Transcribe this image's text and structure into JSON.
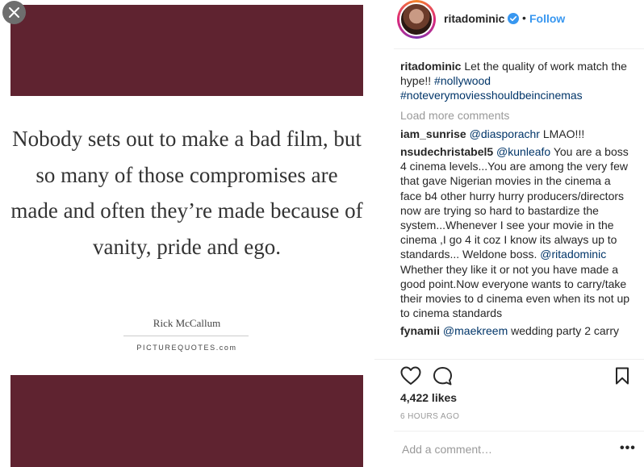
{
  "quote": {
    "text": "Nobody sets out to make a bad film, but so many of those compromises are made and often they’re made because of vanity, pride and ego.",
    "author": "Rick McCallum",
    "site": "PICTUREQUOTES.com"
  },
  "post": {
    "username": "ritadominic",
    "follow_label": "Follow",
    "dot": "•",
    "caption_user": "ritadominic",
    "caption_text": "Let the quality of work match the hype!!",
    "caption_tag1": "#nollywood",
    "caption_tag2": "#noteverymoviesshouldbeincinemas",
    "load_more": "Load more comments",
    "comments": [
      {
        "user": "iam_sunrise",
        "mention": "@diasporachr",
        "text": "LMAO!!!"
      },
      {
        "user": "nsudechristabel5",
        "mention": "@kunleafo",
        "text": "You are a boss 4 cinema levels...You are among the very few that gave Nigerian movies in the cinema a face b4 other hurry hurry producers/directors now are trying so hard to bastardize the system...Whenever I see your movie in the cinema ,I go 4 it coz I know its always up to standards... Weldone boss.",
        "mention2": "@ritadominic",
        "text2": "Whether they like it or not you have made a good point.Now everyone wants to carry/take their movies to d cinema even when its not up to cinema standards"
      },
      {
        "user": "fynamii",
        "mention": "@maekreem",
        "text": "wedding party 2 carry"
      }
    ],
    "likes": "4,422 likes",
    "timestamp": "6 HOURS AGO",
    "add_comment_placeholder": "Add a comment…",
    "more_label": "•••"
  },
  "colors": {
    "maroon": "#5f2330",
    "link": "#003569",
    "follow": "#3897f0",
    "verified": "#3897f0"
  },
  "icons": [
    "close-icon",
    "verified-icon",
    "heart-icon",
    "comment-icon",
    "bookmark-icon",
    "more-icon"
  ]
}
